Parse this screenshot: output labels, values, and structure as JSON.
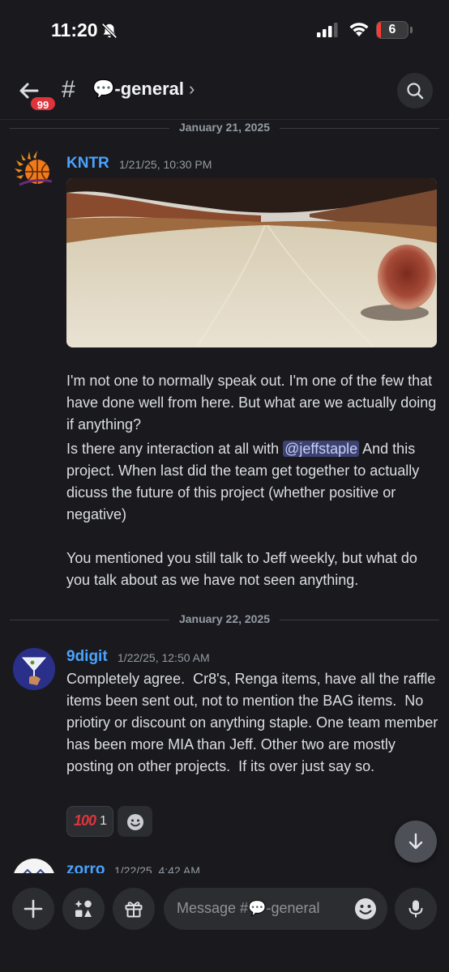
{
  "status_bar": {
    "time": "11:20",
    "battery": "6"
  },
  "header": {
    "unread_count": "99",
    "channel_name": "💬-general",
    "chevron": "›"
  },
  "date_dividers": [
    "January 21, 2025",
    "January 22, 2025"
  ],
  "messages": [
    {
      "author": "KNTR",
      "timestamp": "1/21/25, 10:30 PM",
      "paragraph1": "I'm not one to normally speak out. I'm one of the few that have done well from here. But what are we actually doing if anything?",
      "paragraph2_before": "Is there any interaction at all with ",
      "mention": "@jeffstaple",
      "paragraph2_after": " And this project. When last did the team get together to actually dicuss the future of this project (whether positive or negative)",
      "paragraph3": "You mentioned you still talk to Jeff weekly, but what do you talk about as we have not seen anything."
    },
    {
      "author": "9digit",
      "timestamp": "1/22/25, 12:50 AM",
      "text": "Completely agree.  Cr8's, Renga items, have all the raffle items been sent out, not to mention the BAG items.  No priotiry or discount on anything staple. One team member has been more MIA than Jeff. Other two are mostly posting on other projects.  If its over just say so.",
      "reactions": [
        {
          "emoji": "💯",
          "emoji_text": "100",
          "count": "1"
        }
      ]
    },
    {
      "author": "zorro",
      "timestamp": "1/22/25, 4:42 AM"
    }
  ],
  "composer": {
    "placeholder": "Message #💬-general"
  },
  "colors": {
    "background": "#1a1a1e",
    "author_link": "#4aa3ff",
    "badge": "#e0343d",
    "mention_bg": "#3c4370"
  }
}
